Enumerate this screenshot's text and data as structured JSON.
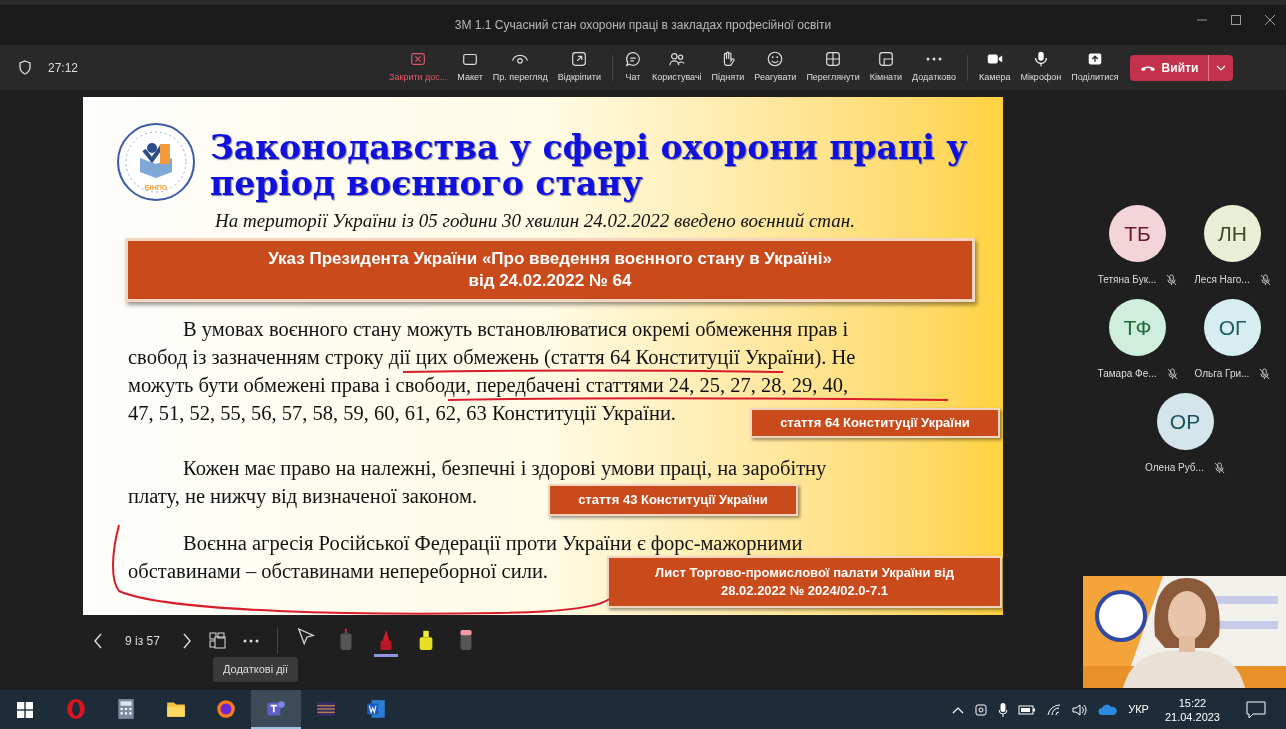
{
  "window": {
    "title": "3М 1.1 Сучасний стан охорони праці в закладах професійної освіти"
  },
  "meeting": {
    "timer": "27:12"
  },
  "toolbar": {
    "groups": [
      [
        {
          "label": "Закрити дос...",
          "kind": "danger"
        },
        {
          "label": "Макет",
          "kind": "normal"
        },
        {
          "label": "Пр. перегляд",
          "kind": "normal"
        },
        {
          "label": "Відкріпити",
          "kind": "normal"
        }
      ],
      [
        {
          "label": "Чат",
          "kind": "normal"
        },
        {
          "label": "Користувачі",
          "kind": "normal"
        },
        {
          "label": "Підняти",
          "kind": "normal"
        },
        {
          "label": "Реагувати",
          "kind": "normal"
        },
        {
          "label": "Переглянути",
          "kind": "normal"
        },
        {
          "label": "Кімнати",
          "kind": "normal"
        },
        {
          "label": "Додатково",
          "kind": "normal"
        }
      ],
      [
        {
          "label": "Камера",
          "kind": "normal"
        },
        {
          "label": "Мікрофон",
          "kind": "normal"
        },
        {
          "label": "Поділитися",
          "kind": "normal"
        }
      ]
    ],
    "leave": {
      "label": "Вийти"
    }
  },
  "slide": {
    "logo_text": "БІНПО",
    "title": "Законодавства у сфері охорони праці у\nперіод воєнного стану",
    "subtitle": "На території України із 05 години 30 хвилин 24.02.2022 введено воєнний стан.",
    "decree": "Указ Президента України «Про введення воєнного стану в Україні»\nвід 24.02.2022 № 64",
    "paragraphs": [
      {
        "lines": [
          "В умовах воєнного стану можуть встановлюватися окремі обмеження прав і",
          "свобод із зазначенням строку дії цих обмежень (стаття 64 Конституції України). Не",
          "можуть бути обмежені права і свободи, передбачені статтями 24, 25, 27, 28, 29, 40,",
          "47, 51, 52, 55, 56, 57, 58, 59, 60, 61, 62, 63 Конституції України."
        ],
        "source": "стаття 64 Конституції України"
      },
      {
        "lines": [
          "Кожен має право на належні, безпечні і здорові умови праці, на заробітну",
          "плату, не нижчу від визначеної законом."
        ],
        "source": "стаття 43 Конституції України"
      },
      {
        "lines": [
          "Воєнна агресія Російської Федерації проти України є форс-мажорними",
          "обставинами – обставинами непереборної сили."
        ],
        "source": "Лист Торгово-промислової палати України від\n28.02.2022 № 2024/02.0-7.1"
      }
    ]
  },
  "participants": [
    {
      "initials": "ТБ",
      "name": "Тетяна Бук...",
      "muted": true,
      "color": "#f3d4d8"
    },
    {
      "initials": "ЛН",
      "name": "Леся Наго...",
      "muted": true,
      "color": "#e9efd6"
    },
    {
      "initials": "ТФ",
      "name": "Тамара Фе...",
      "muted": true,
      "color": "#cfeedd"
    },
    {
      "initials": "ОГ",
      "name": "Ольга Гри...",
      "muted": true,
      "color": "#d6eef0"
    },
    {
      "initials": "ОР",
      "name": "Олена Руб...",
      "muted": true,
      "color": "#d4e6ec"
    }
  ],
  "presenter": {
    "page": "9 із 57",
    "tooltip": "Додаткові дії",
    "tools": [
      {
        "selected": false
      },
      {
        "selected": false
      },
      {
        "selected": true
      },
      {
        "selected": false
      },
      {
        "selected": false
      }
    ]
  },
  "taskbar": {
    "apps": [
      {
        "selected": false
      },
      {
        "selected": false
      },
      {
        "selected": false
      },
      {
        "selected": false
      },
      {
        "selected": true
      },
      {
        "selected": false
      },
      {
        "selected": false
      }
    ],
    "language": "УКР",
    "time": "15:22",
    "date": "21.04.2023"
  }
}
